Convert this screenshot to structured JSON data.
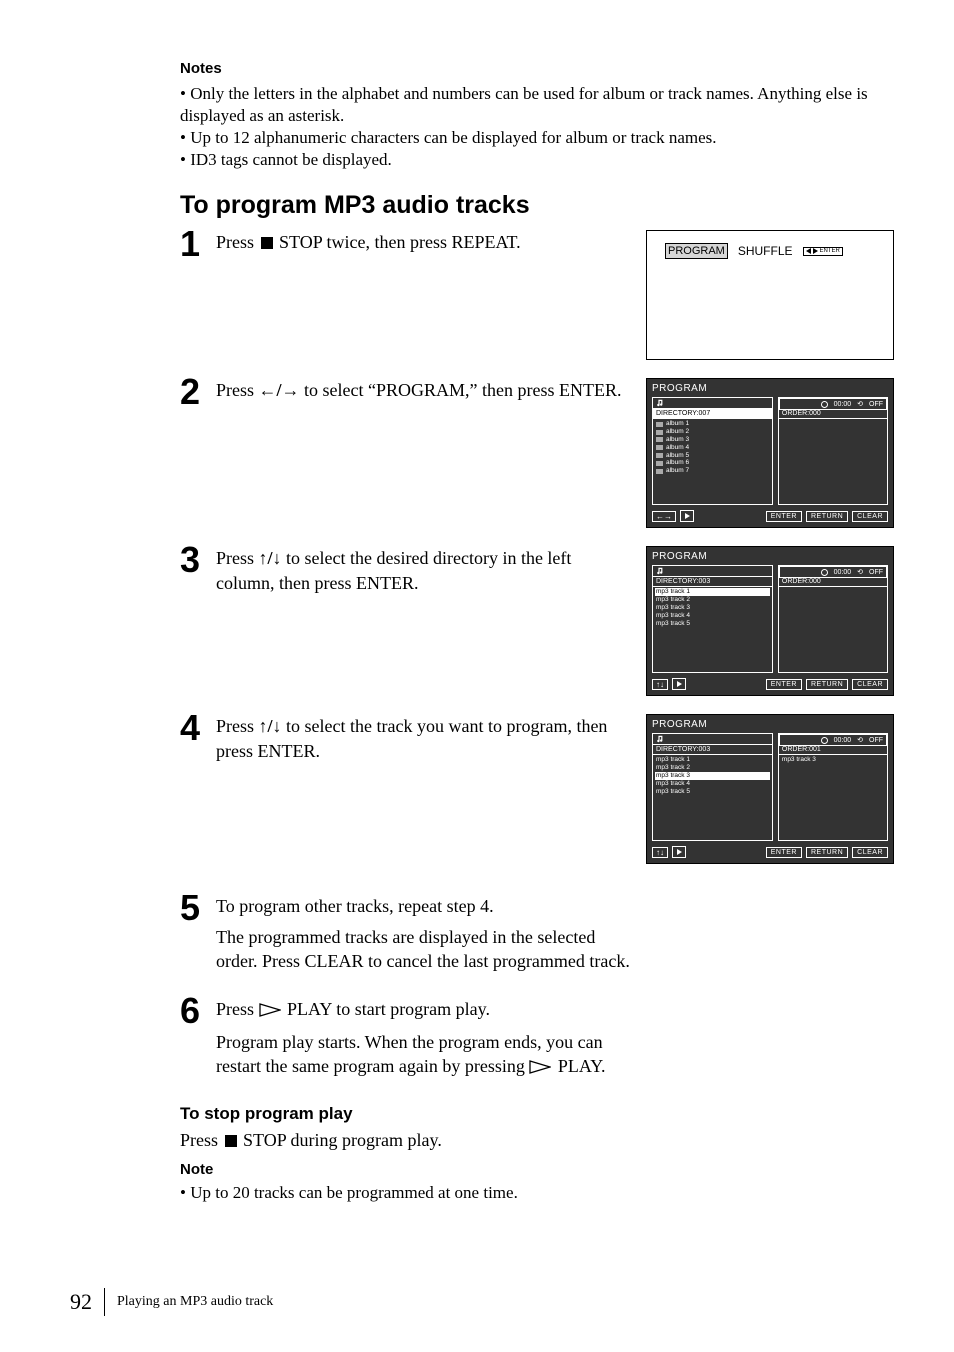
{
  "notes": {
    "heading": "Notes",
    "items": [
      "Only the letters in the alphabet and numbers can be used for album or track names.  Anything else is displayed as an asterisk.",
      "Up to 12 alphanumeric characters can be displayed for album or track names.",
      "ID3 tags cannot be displayed."
    ]
  },
  "section_title": "To program MP3 audio tracks",
  "steps": {
    "s1": {
      "num": "1",
      "pre": "Press ",
      "post": " STOP twice, then press REPEAT."
    },
    "s2": {
      "num": "2",
      "a": "Press ",
      "b": " to select “PROGRAM,” then press ENTER."
    },
    "s3": {
      "num": "3",
      "a": "Press ",
      "b": " to select the desired directory in the left column, then press ENTER."
    },
    "s4": {
      "num": "4",
      "a": "Press ",
      "b": " to select the track you want to program, then press ENTER."
    },
    "s5": {
      "num": "5",
      "line1": "To program other tracks, repeat step 4.",
      "line2": "The programmed tracks are displayed in the selected order.  Press CLEAR to cancel the last programmed track."
    },
    "s6": {
      "num": "6",
      "a": "Press ",
      "b": " PLAY to start program play.",
      "line2a": "Program play starts.  When the program ends, you can restart the same program again by pressing ",
      "line2b": " PLAY."
    }
  },
  "lcd1": {
    "program": "PROGRAM",
    "shuffle": "SHUFFLE",
    "enter": "ENTER"
  },
  "osd_common": {
    "title": "PROGRAM",
    "enter": "ENTER",
    "return": "RETURN",
    "clear": "CLEAR",
    "off": "OFF",
    "time": "00:00"
  },
  "osd2": {
    "dir": "DIRECTORY:007",
    "order": "ORDER:000",
    "albums": [
      "album 1",
      "album 2",
      "album 3",
      "album 4",
      "album 5",
      "album 6",
      "album 7"
    ],
    "arrows": "←→"
  },
  "osd3": {
    "dir": "DIRECTORY:003",
    "order": "ORDER:000",
    "sel": "mp3 track 1",
    "tracks": [
      "mp3 track 2",
      "mp3 track 3",
      "mp3 track 4",
      "mp3 track 5"
    ],
    "arrows": "↑↓"
  },
  "osd4": {
    "dir": "DIRECTORY:003",
    "order": "ORDER:001",
    "tracks_pre": [
      "mp3 track 1",
      "mp3 track 2"
    ],
    "sel": "mp3 track 3",
    "tracks_post": [
      "mp3 track 4",
      "mp3 track 5"
    ],
    "right_track": "mp3 track 3",
    "arrows": "↑↓"
  },
  "stop_section": {
    "heading": "To stop program play",
    "pre": "Press ",
    "post": " STOP during program play."
  },
  "note2": {
    "heading": "Note",
    "item": "Up to 20 tracks can be programmed at one time."
  },
  "footer": {
    "page": "92",
    "title": "Playing an MP3 audio track"
  }
}
